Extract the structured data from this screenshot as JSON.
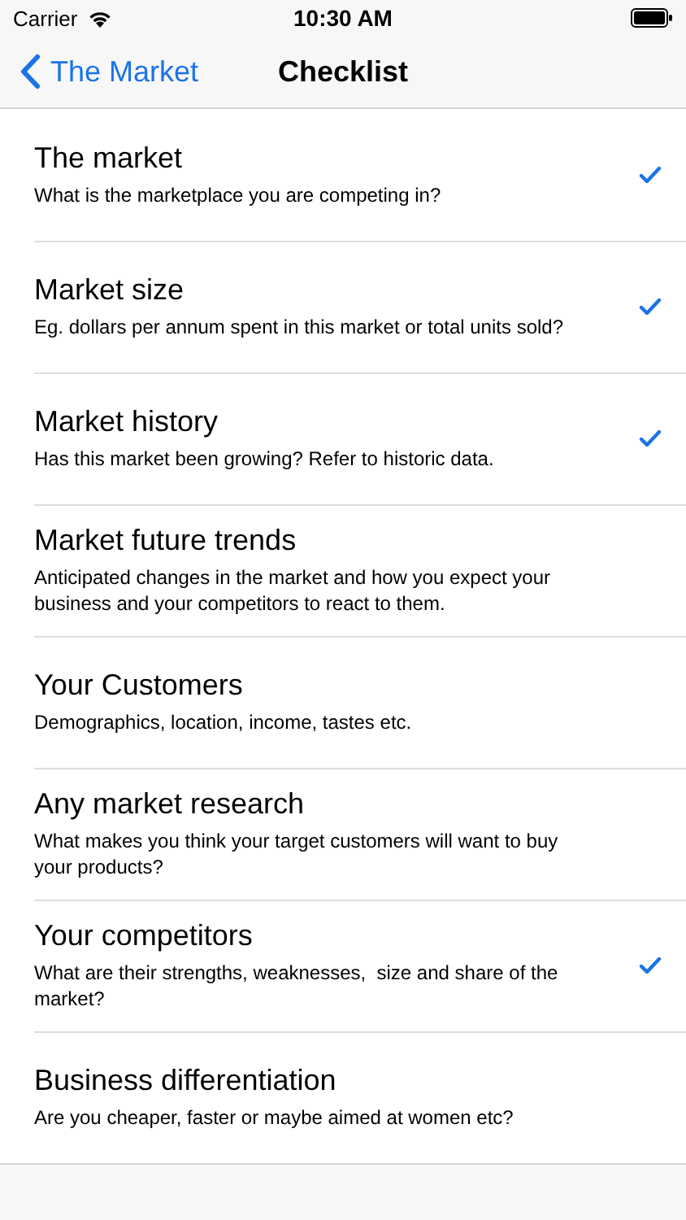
{
  "status_bar": {
    "carrier": "Carrier",
    "time": "10:30 AM"
  },
  "nav": {
    "back": "The Market",
    "title": "Checklist"
  },
  "items": [
    {
      "title": "The market",
      "subtitle": "What is the marketplace you are competing in?",
      "checked": true
    },
    {
      "title": "Market size",
      "subtitle": "Eg. dollars per annum spent in this market or total units sold?",
      "checked": true
    },
    {
      "title": "Market history",
      "subtitle": "Has this market been growing? Refer to historic data.",
      "checked": true
    },
    {
      "title": "Market future trends",
      "subtitle": "Anticipated changes in the market and how you expect your business and your competitors to react to them.",
      "checked": false
    },
    {
      "title": "Your Customers",
      "subtitle": "Demographics, location, income, tastes etc.",
      "checked": false
    },
    {
      "title": "Any market research",
      "subtitle": "What makes you think your target customers will want to buy your products?",
      "checked": false
    },
    {
      "title": "Your competitors",
      "subtitle": "What are their strengths, weaknesses,  size and share of the market?",
      "checked": true
    },
    {
      "title": "Business differentiation",
      "subtitle": "Are you cheaper, faster or maybe aimed at women etc?",
      "checked": false
    }
  ]
}
